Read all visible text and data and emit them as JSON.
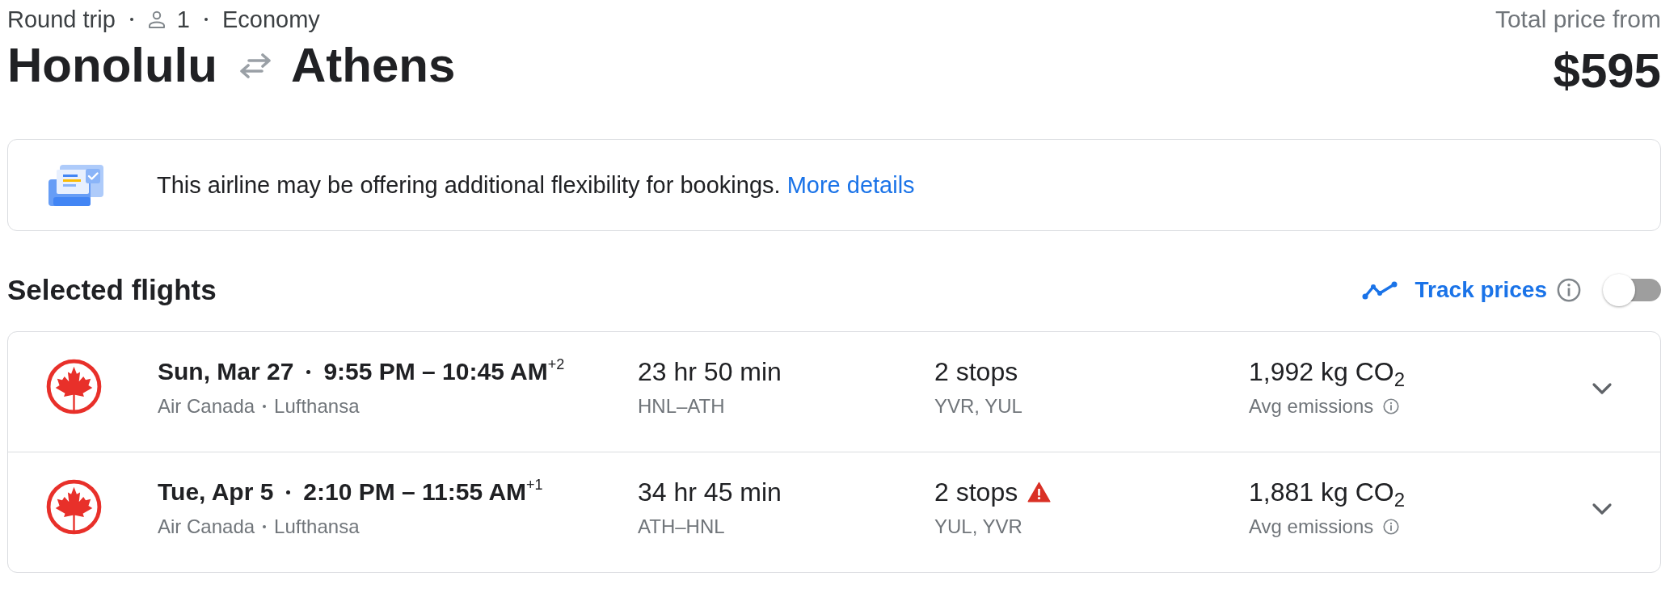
{
  "trip": {
    "type": "Round trip",
    "passengers": "1",
    "cabin": "Economy",
    "origin": "Honolulu",
    "destination": "Athens"
  },
  "price": {
    "label": "Total price from",
    "amount": "$595"
  },
  "notice": {
    "text": "This airline may be offering additional flexibility for bookings.",
    "link": "More details"
  },
  "selected_flights": {
    "title": "Selected flights",
    "track_prices": {
      "label": "Track prices",
      "on": false
    },
    "flights": [
      {
        "date": "Sun, Mar 27",
        "times": "9:55 PM – 10:45 AM$^{+2}$",
        "airlines": [
          "Air Canada",
          "Lufthansa"
        ],
        "duration": "23 hr 50 min",
        "route": "HNL–ATH",
        "stops": "2 stops",
        "warning": false,
        "layovers": "YVR, YUL",
        "emissions": "1,992 kg CO$_{2}$",
        "emissions_label": "Avg emissions",
        "expanded": false
      },
      {
        "date": "Tue, Apr 5",
        "times": "2:10 PM – 11:55 AM$^{+1}$",
        "airlines": [
          "Air Canada",
          "Lufthansa"
        ],
        "duration": "34 hr 45 min",
        "route": "ATH–HNL",
        "stops": "2 stops",
        "warning": true,
        "layovers": "YUL, YVR",
        "emissions": "1,881 kg CO$_{2}$",
        "emissions_label": "Avg emissions",
        "expanded": false
      }
    ]
  }
}
